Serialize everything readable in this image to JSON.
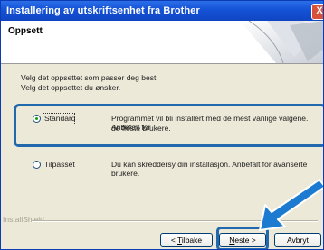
{
  "window": {
    "title": "Installering av utskriftsenhet fra Brother",
    "close_label": "X"
  },
  "header": {
    "title": "Oppsett"
  },
  "description": {
    "line1": "Velg det oppsettet som passer deg best.",
    "line2": "Velg det oppsettet du ønsker."
  },
  "options": [
    {
      "label": "Standard",
      "selected": true,
      "desc_line1": "Programmet vil bli installert med de mest vanlige valgene. Anbefalt for",
      "desc_line2": "de fleste brukere."
    },
    {
      "label": "Tilpasset",
      "selected": false,
      "desc_line1": "Du kan skreddersy din installasjon. Anbefalt for avanserte brukere."
    }
  ],
  "footer": {
    "brand": "InstallShield"
  },
  "buttons": {
    "back_mnemonic": "T",
    "back_rest": "ilbake",
    "back_prefix": "< ",
    "next_mnemonic": "N",
    "next_rest": "este >",
    "cancel": "Avbryt"
  },
  "colors": {
    "highlight": "#2168ac",
    "arrow": "#1c7bd0",
    "title_bar": "#1552d6"
  }
}
